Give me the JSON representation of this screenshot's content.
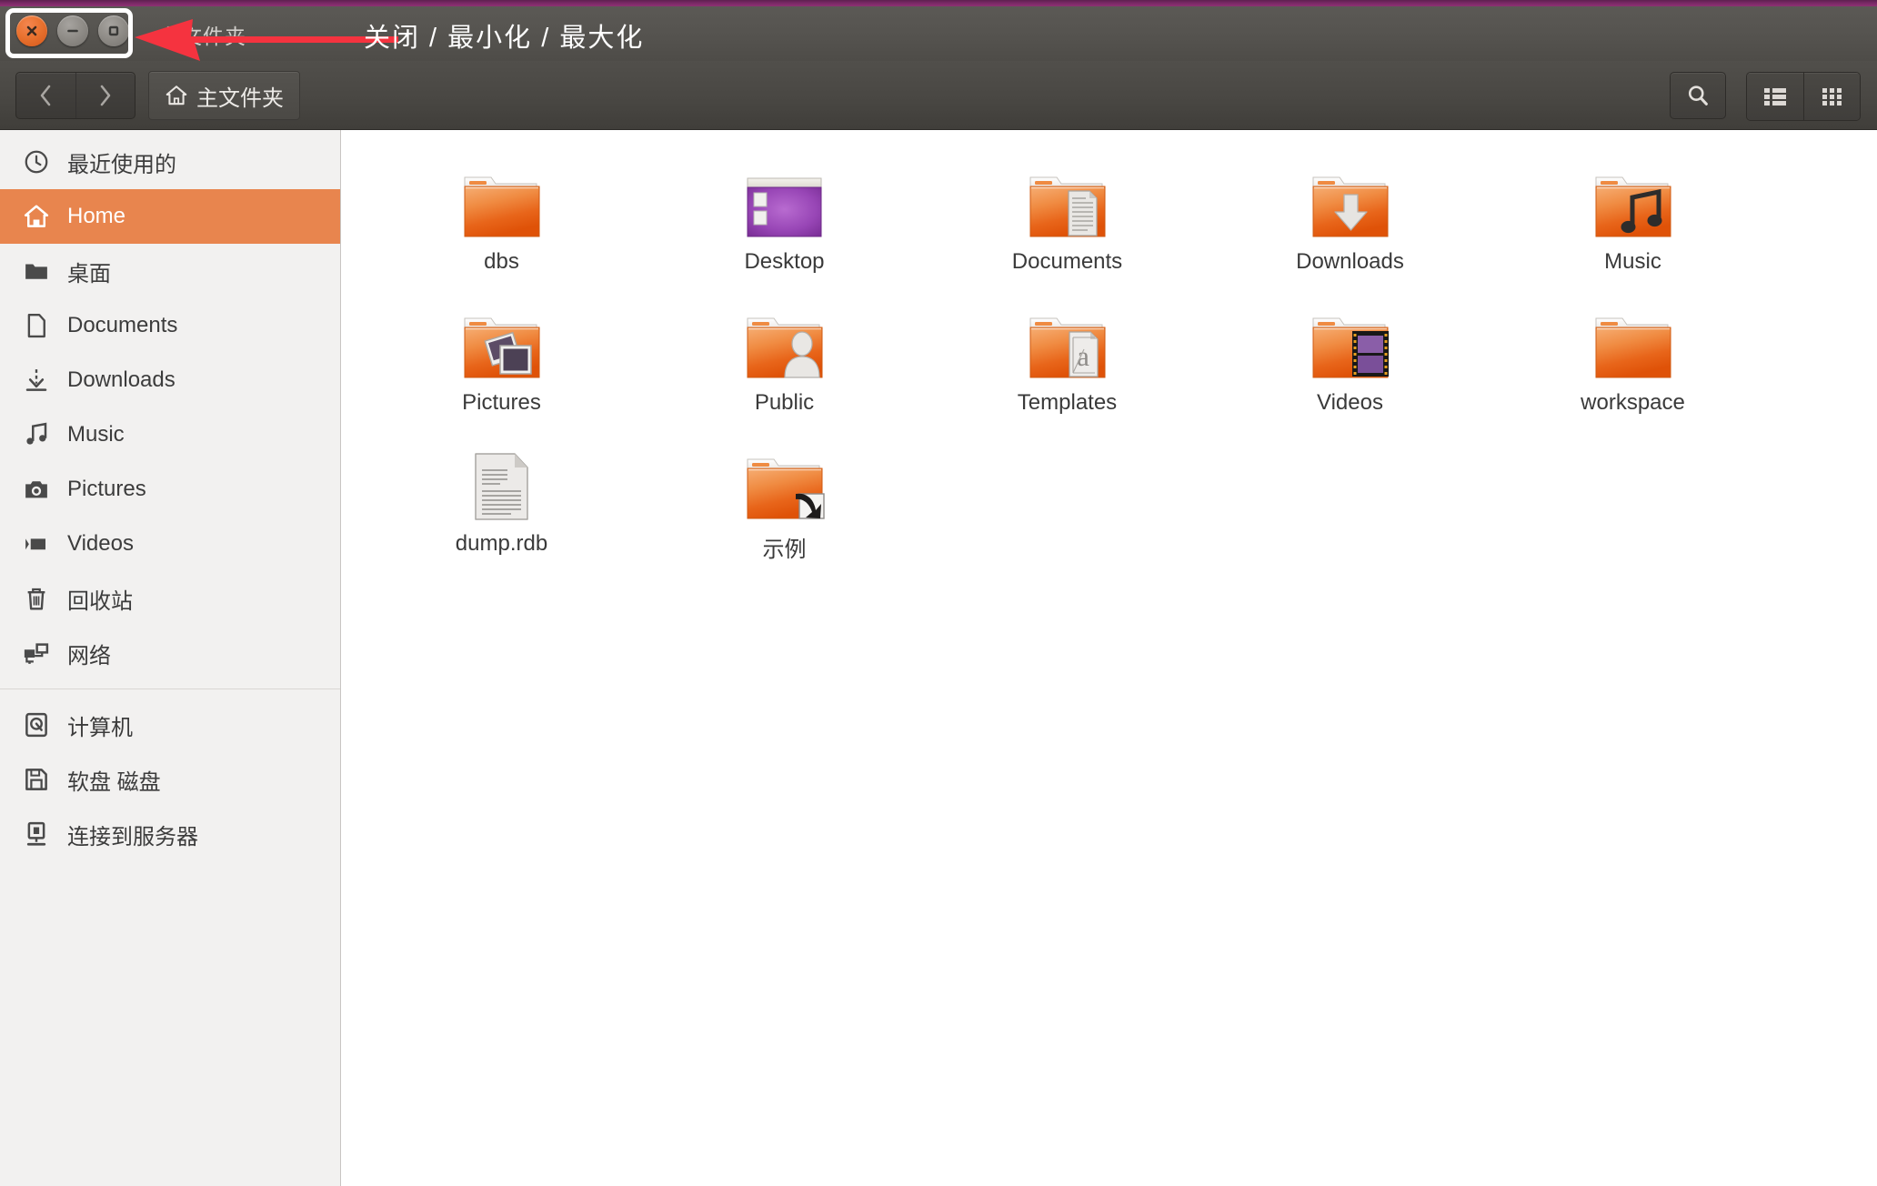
{
  "window": {
    "title": "主文件夹",
    "annotation": "关闭 / 最小化 / 最大化",
    "controls": {
      "close": "关闭",
      "minimize": "最小化",
      "maximize": "最大化"
    }
  },
  "toolbar": {
    "back": "后退",
    "forward": "前进",
    "path_label": "主文件夹",
    "search": "搜索",
    "view_list": "列表视图",
    "view_grid": "图标视图"
  },
  "sidebar": {
    "groups": [
      {
        "items": [
          {
            "label": "最近使用的",
            "icon": "clock-icon",
            "active": false
          },
          {
            "label": "Home",
            "icon": "home-icon",
            "active": true
          },
          {
            "label": "桌面",
            "icon": "folder-icon",
            "active": false
          },
          {
            "label": "Documents",
            "icon": "document-icon",
            "active": false
          },
          {
            "label": "Downloads",
            "icon": "download-icon",
            "active": false
          },
          {
            "label": "Music",
            "icon": "music-icon",
            "active": false
          },
          {
            "label": "Pictures",
            "icon": "camera-icon",
            "active": false
          },
          {
            "label": "Videos",
            "icon": "video-icon",
            "active": false
          },
          {
            "label": "回收站",
            "icon": "trash-icon",
            "active": false
          },
          {
            "label": "网络",
            "icon": "network-icon",
            "active": false
          }
        ]
      },
      {
        "items": [
          {
            "label": "计算机",
            "icon": "computer-disk-icon",
            "active": false
          },
          {
            "label": "软盘 磁盘",
            "icon": "floppy-disk-icon",
            "active": false
          },
          {
            "label": "连接到服务器",
            "icon": "server-connect-icon",
            "active": false
          }
        ]
      }
    ]
  },
  "files": [
    {
      "name": "dbs",
      "icon": "folder-plain-icon"
    },
    {
      "name": "Desktop",
      "icon": "folder-desktop-icon"
    },
    {
      "name": "Documents",
      "icon": "folder-documents-icon"
    },
    {
      "name": "Downloads",
      "icon": "folder-downloads-icon"
    },
    {
      "name": "Music",
      "icon": "folder-music-icon"
    },
    {
      "name": "Pictures",
      "icon": "folder-pictures-icon"
    },
    {
      "name": "Public",
      "icon": "folder-public-icon"
    },
    {
      "name": "Templates",
      "icon": "folder-templates-icon"
    },
    {
      "name": "Videos",
      "icon": "folder-videos-icon"
    },
    {
      "name": "workspace",
      "icon": "folder-plain-icon"
    },
    {
      "name": "dump.rdb",
      "icon": "text-file-icon"
    },
    {
      "name": "示例",
      "icon": "folder-symlink-icon"
    }
  ],
  "colors": {
    "accent_orange": "#e8854e",
    "titlebar": "#545250",
    "sidebar_bg": "#f2f1f0",
    "content_bg": "#ffffff",
    "annotation_red": "#f5333f",
    "highlight_white": "#ffffff",
    "top_strip_purple": "#7d2a68"
  }
}
